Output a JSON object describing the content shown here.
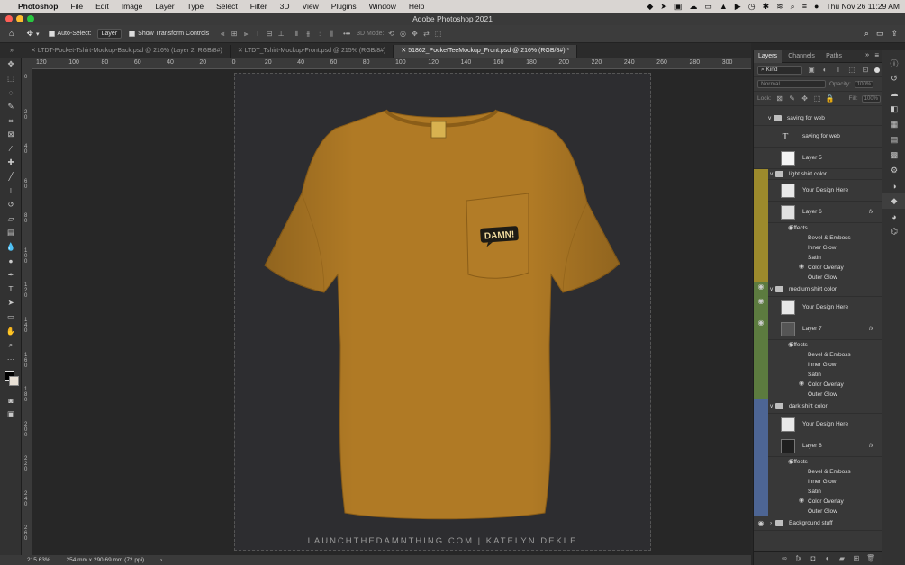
{
  "menubar": {
    "apple": "",
    "app": "Photoshop",
    "items": [
      "File",
      "Edit",
      "Image",
      "Layer",
      "Type",
      "Select",
      "Filter",
      "3D",
      "View",
      "Plugins",
      "Window",
      "Help"
    ],
    "clock": "Thu Nov 26  11:29 AM"
  },
  "window": {
    "title": "Adobe Photoshop 2021"
  },
  "options": {
    "auto_select_label": "Auto-Select:",
    "auto_select_value": "Layer",
    "transform_label": "Show Transform Controls",
    "mode3d_label": "3D Mode:"
  },
  "tabs": [
    {
      "label": "LTDT-Pocket-Tshirt-Mockup-Back.psd @ 216% (Layer 2, RGB/8#)"
    },
    {
      "label": "LTDT_Tshirt-Mockup-Front.psd @ 215% (RGB/8#)"
    },
    {
      "label": "51862_PocketTeeMockup_Front.psd @ 216% (RGB/8#) *"
    }
  ],
  "ruler": {
    "top": [
      "120",
      "100",
      "80",
      "60",
      "40",
      "20",
      "0",
      "20",
      "40",
      "60",
      "80",
      "100",
      "120",
      "140",
      "160",
      "180",
      "200",
      "220",
      "240",
      "260",
      "280",
      "300"
    ],
    "left": [
      "0",
      "2 0",
      "4 0",
      "6 0",
      "8 0",
      "1 0 0",
      "1 2 0",
      "1 4 0",
      "1 6 0",
      "1 8 0",
      "2 0 0",
      "2 2 0",
      "2 4 0",
      "2 6 0"
    ]
  },
  "canvas": {
    "pocket_text": "DAMN!",
    "footer": "LAUNCHTHEDAMNTHING.COM  |  KATELYN DEKLE",
    "shirt_color": "#b07a25"
  },
  "status": {
    "zoom": "215.63%",
    "size": "254 mm x 290.69 mm (72 ppi)"
  },
  "panel": {
    "tabs": [
      "Layers",
      "Channels",
      "Paths"
    ],
    "kind_label": "Kind",
    "blend_mode": "Normal",
    "opacity_label": "Opacity:",
    "opacity_value": "100%",
    "lock_label": "Lock:",
    "fill_label": "Fill:",
    "fill_value": "100%",
    "layers": [
      {
        "type": "group",
        "name": "saving for web",
        "color": "#383838"
      },
      {
        "type": "text",
        "name": "saving for web",
        "color": "#383838"
      },
      {
        "type": "layer",
        "name": "Layer 5",
        "color": "#383838"
      },
      {
        "type": "group",
        "name": "light shirt color",
        "color": "#9c8a2c"
      },
      {
        "type": "layer",
        "name": "Your Design Here",
        "color": "#9c8a2c"
      },
      {
        "type": "layer",
        "name": "Layer 6",
        "color": "#9c8a2c",
        "fx": "fx"
      },
      {
        "type": "group",
        "name": "medium shirt color",
        "color": "#5c7b3f"
      },
      {
        "type": "layer",
        "name": "Your Design Here",
        "color": "#5c7b3f"
      },
      {
        "type": "layer",
        "name": "Layer 7",
        "color": "#5c7b3f",
        "fx": "fx"
      },
      {
        "type": "group",
        "name": "dark shirt color",
        "color": "#4d6594"
      },
      {
        "type": "layer",
        "name": "Your Design Here",
        "color": "#4d6594"
      },
      {
        "type": "layer",
        "name": "Layer 8",
        "color": "#4d6594",
        "fx": "fx"
      },
      {
        "type": "group",
        "name": "Background stuff",
        "color": "#383838"
      }
    ],
    "effects_label": "Effects",
    "effects": [
      "Bevel & Emboss",
      "Inner Glow",
      "Satin",
      "Color Overlay",
      "Outer Glow"
    ]
  }
}
